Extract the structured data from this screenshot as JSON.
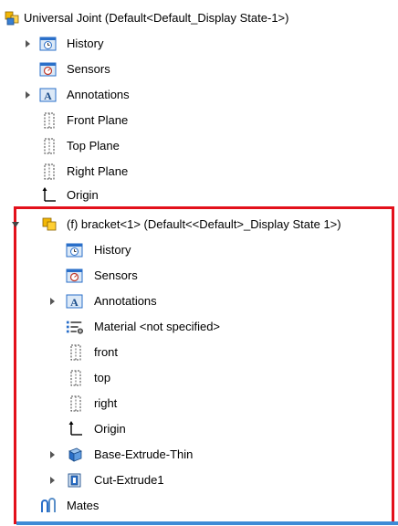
{
  "tree": {
    "root": {
      "label": "Universal Joint  (Default<Default_Display State-1>)",
      "icon": "assembly-icon"
    },
    "root_children": [
      {
        "label": "History",
        "icon": "history-icon",
        "expandable": true
      },
      {
        "label": "Sensors",
        "icon": "sensors-icon",
        "expandable": false
      },
      {
        "label": "Annotations",
        "icon": "annotations-icon",
        "expandable": true
      },
      {
        "label": "Front Plane",
        "icon": "plane-icon",
        "expandable": false
      },
      {
        "label": "Top Plane",
        "icon": "plane-icon",
        "expandable": false
      },
      {
        "label": "Right Plane",
        "icon": "plane-icon",
        "expandable": false
      },
      {
        "label": "Origin",
        "icon": "origin-icon",
        "expandable": false
      }
    ],
    "component": {
      "label": "(f) bracket<1> (Default<<Default>_Display State 1>)",
      "icon": "part-component-icon",
      "expanded": true,
      "children": [
        {
          "label": "History",
          "icon": "history-icon",
          "expandable": false
        },
        {
          "label": "Sensors",
          "icon": "sensors-icon",
          "expandable": false
        },
        {
          "label": "Annotations",
          "icon": "annotations-icon",
          "expandable": true
        },
        {
          "label": "Material <not specified>",
          "icon": "material-icon",
          "expandable": false
        },
        {
          "label": "front",
          "icon": "plane-icon",
          "expandable": false
        },
        {
          "label": "top",
          "icon": "plane-icon",
          "expandable": false
        },
        {
          "label": "right",
          "icon": "plane-icon",
          "expandable": false
        },
        {
          "label": "Origin",
          "icon": "origin-icon",
          "expandable": false
        },
        {
          "label": "Base-Extrude-Thin",
          "icon": "extrude-icon",
          "expandable": true
        },
        {
          "label": "Cut-Extrude1",
          "icon": "cut-extrude-icon",
          "expandable": true
        }
      ]
    },
    "mates": {
      "label": "Mates",
      "icon": "mates-icon"
    }
  },
  "colors": {
    "highlight_border": "#e3101b",
    "selection_bar": "#3d8bd6",
    "assembly_yellow": "#f2b705",
    "icon_blue": "#2a6fc9"
  }
}
